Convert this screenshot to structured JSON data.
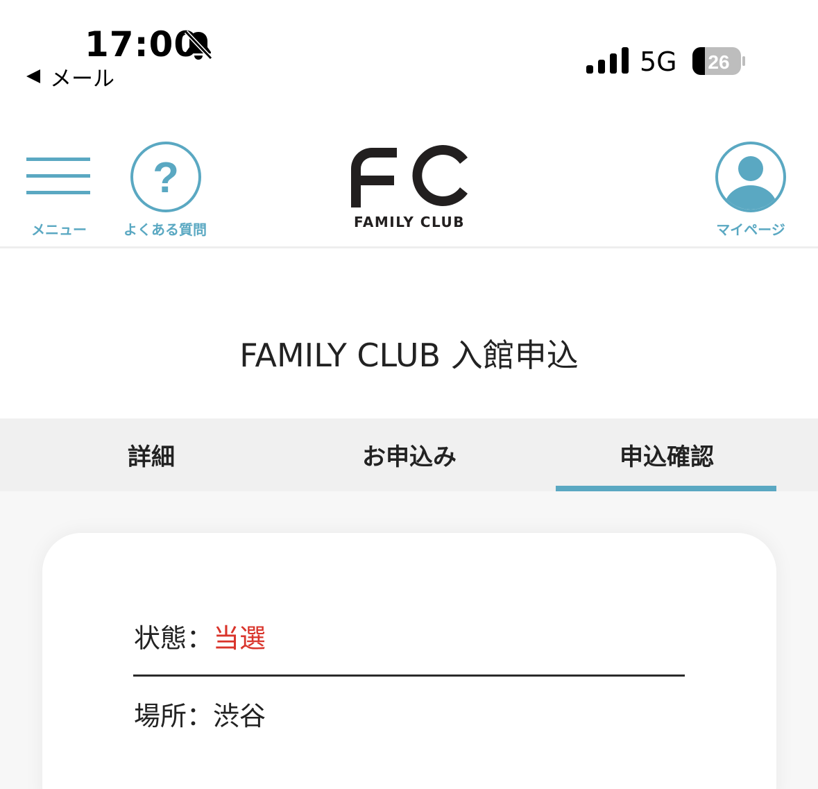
{
  "status_bar": {
    "time": "17:00",
    "back_label": "メール",
    "network": "5G",
    "battery": "26",
    "icons": [
      "bell-slash-icon",
      "signal-icon",
      "battery-icon"
    ]
  },
  "header": {
    "menu_label": "メニュー",
    "faq_label": "よくある質問",
    "logo_text": "FC",
    "logo_subtext": "FAMILY CLUB",
    "mypage_label": "マイページ"
  },
  "page": {
    "title": "FAMILY CLUB 入館申込"
  },
  "tabs": [
    {
      "label": "詳細",
      "active": false
    },
    {
      "label": "お申込み",
      "active": false
    },
    {
      "label": "申込確認",
      "active": true
    }
  ],
  "details": {
    "status_label": "状態：",
    "status_value": "当選",
    "place_label": "場所：",
    "place_value": "渋谷"
  },
  "colors": {
    "accent": "#5aa8c2",
    "status_win": "#d9342b",
    "tab_bg": "#f0f0f0",
    "logo": "#221f1f"
  }
}
